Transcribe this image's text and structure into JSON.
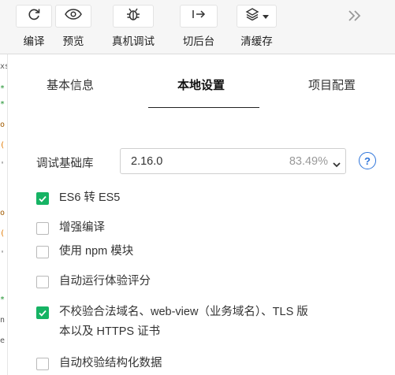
{
  "toolbar": {
    "items": [
      {
        "label": "编译",
        "icon": "refresh-icon"
      },
      {
        "label": "预览",
        "icon": "eye-icon"
      },
      {
        "label": "真机调试",
        "icon": "bug-icon"
      },
      {
        "label": "切后台",
        "icon": "switch-background-icon"
      },
      {
        "label": "清缓存",
        "icon": "layers-icon"
      }
    ],
    "more_icon": "double-chevron-right-icon"
  },
  "tabs": [
    {
      "label": "基本信息",
      "active": false
    },
    {
      "label": "本地设置",
      "active": true
    },
    {
      "label": "项目配置",
      "active": false
    }
  ],
  "base_library": {
    "label": "调试基础库",
    "version": "2.16.0",
    "percentage": "83.49%",
    "help_symbol": "?"
  },
  "options": [
    {
      "label": "ES6 转 ES5",
      "checked": true
    },
    {
      "label": "增强编译",
      "checked": false
    },
    {
      "label": "使用 npm 模块",
      "checked": false
    },
    {
      "label": "自动运行体验评分",
      "checked": false
    },
    {
      "label_line1": "不校验合法域名、web-view（业务域名）、TLS 版",
      "label_line2": "本以及 HTTPS 证书",
      "checked": true
    },
    {
      "label": "自动校验结构化数据",
      "checked": false
    }
  ],
  "colors": {
    "accent_green": "#16b364",
    "help_blue": "#2d74da",
    "toolbar_bg": "#f6f6f6"
  }
}
